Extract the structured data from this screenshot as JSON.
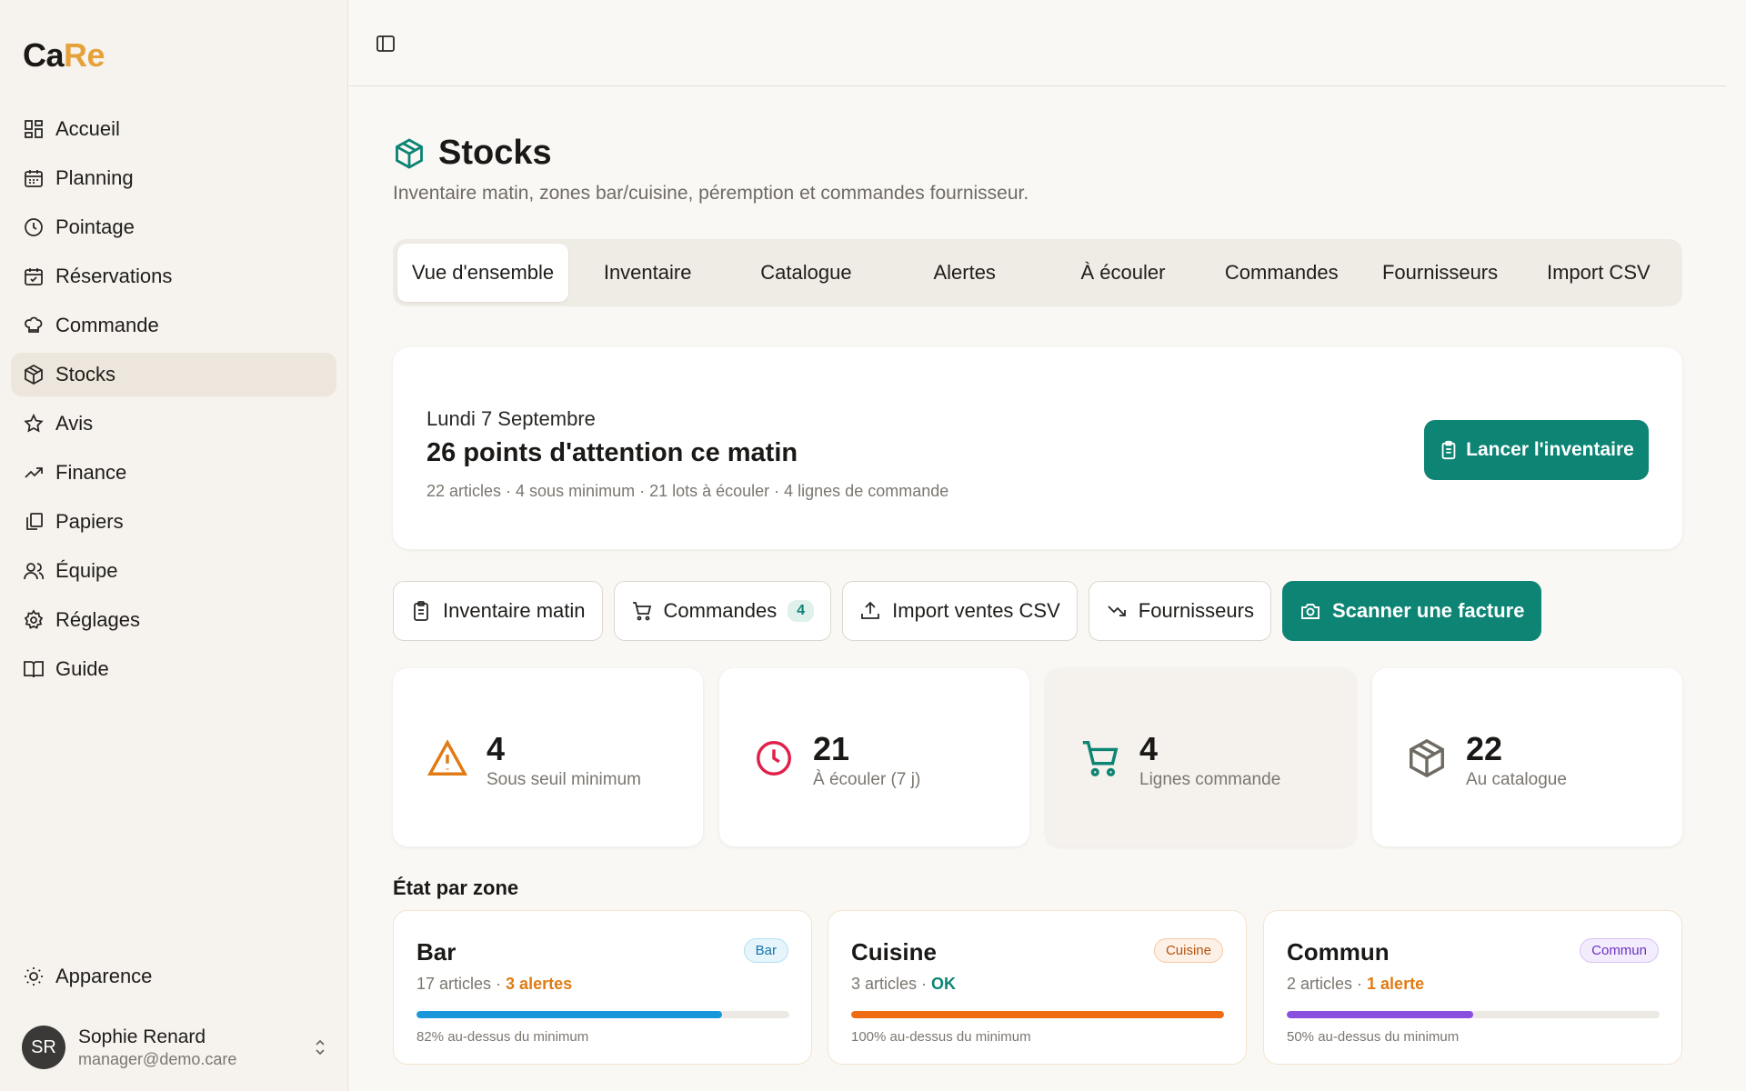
{
  "brand": {
    "logo_part1": "Ca",
    "logo_part2": "Re",
    "accent": "#e5a23a"
  },
  "sidebar": {
    "items": [
      {
        "label": "Accueil",
        "icon": "dashboard-icon"
      },
      {
        "label": "Planning",
        "icon": "calendar-icon"
      },
      {
        "label": "Pointage",
        "icon": "clock-icon"
      },
      {
        "label": "Réservations",
        "icon": "calendar-check-icon"
      },
      {
        "label": "Commande",
        "icon": "chef-hat-icon"
      },
      {
        "label": "Stocks",
        "icon": "package-icon",
        "active": true
      },
      {
        "label": "Avis",
        "icon": "star-icon"
      },
      {
        "label": "Finance",
        "icon": "trending-up-icon"
      },
      {
        "label": "Papiers",
        "icon": "documents-icon"
      },
      {
        "label": "Équipe",
        "icon": "team-icon"
      },
      {
        "label": "Réglages",
        "icon": "gear-icon"
      },
      {
        "label": "Guide",
        "icon": "book-icon"
      }
    ],
    "appearance": "Apparence",
    "user": {
      "initials": "SR",
      "name": "Sophie Renard",
      "email": "manager@demo.care"
    }
  },
  "page": {
    "title": "Stocks",
    "subtitle": "Inventaire matin, zones bar/cuisine, péremption et commandes fournisseur."
  },
  "tabs": [
    "Vue d'ensemble",
    "Inventaire",
    "Catalogue",
    "Alertes",
    "À écouler",
    "Commandes",
    "Fournisseurs",
    "Import CSV"
  ],
  "hero": {
    "date": "Lundi 7 Septembre",
    "title": "26 points d'attention ce matin",
    "summary": "22 articles · 4 sous minimum · 21 lots à écouler · 4 lignes de commande",
    "cta": "Lancer l'inventaire"
  },
  "quick_actions": {
    "inventaire": "Inventaire matin",
    "commandes": "Commandes",
    "commandes_badge": "4",
    "import": "Import ventes CSV",
    "fournisseurs": "Fournisseurs",
    "scanner": "Scanner une facture"
  },
  "stats": [
    {
      "value": "4",
      "label": "Sous seuil minimum"
    },
    {
      "value": "21",
      "label": "À écouler (7 j)"
    },
    {
      "value": "4",
      "label": "Lignes commande"
    },
    {
      "value": "22",
      "label": "Au catalogue"
    }
  ],
  "zones": {
    "title": "État par zone",
    "items": [
      {
        "name": "Bar",
        "badge": "Bar",
        "articles": "17 articles",
        "sep": " · ",
        "status": "3 alertes",
        "footer": "82% au-dessus du minimum",
        "percent": 82,
        "color": "#1a97db"
      },
      {
        "name": "Cuisine",
        "badge": "Cuisine",
        "articles": "3 articles",
        "sep": " · ",
        "status": "OK",
        "footer": "100% au-dessus du minimum",
        "percent": 100,
        "color": "#f06c12"
      },
      {
        "name": "Commun",
        "badge": "Commun",
        "articles": "2 articles",
        "sep": " · ",
        "status": "1 alerte",
        "footer": "50% au-dessus du minimum",
        "percent": 50,
        "color": "#8b4fe0"
      }
    ]
  },
  "colors": {
    "primary": "#0d8474",
    "warning": "#e07b14",
    "danger": "#e0204a"
  }
}
